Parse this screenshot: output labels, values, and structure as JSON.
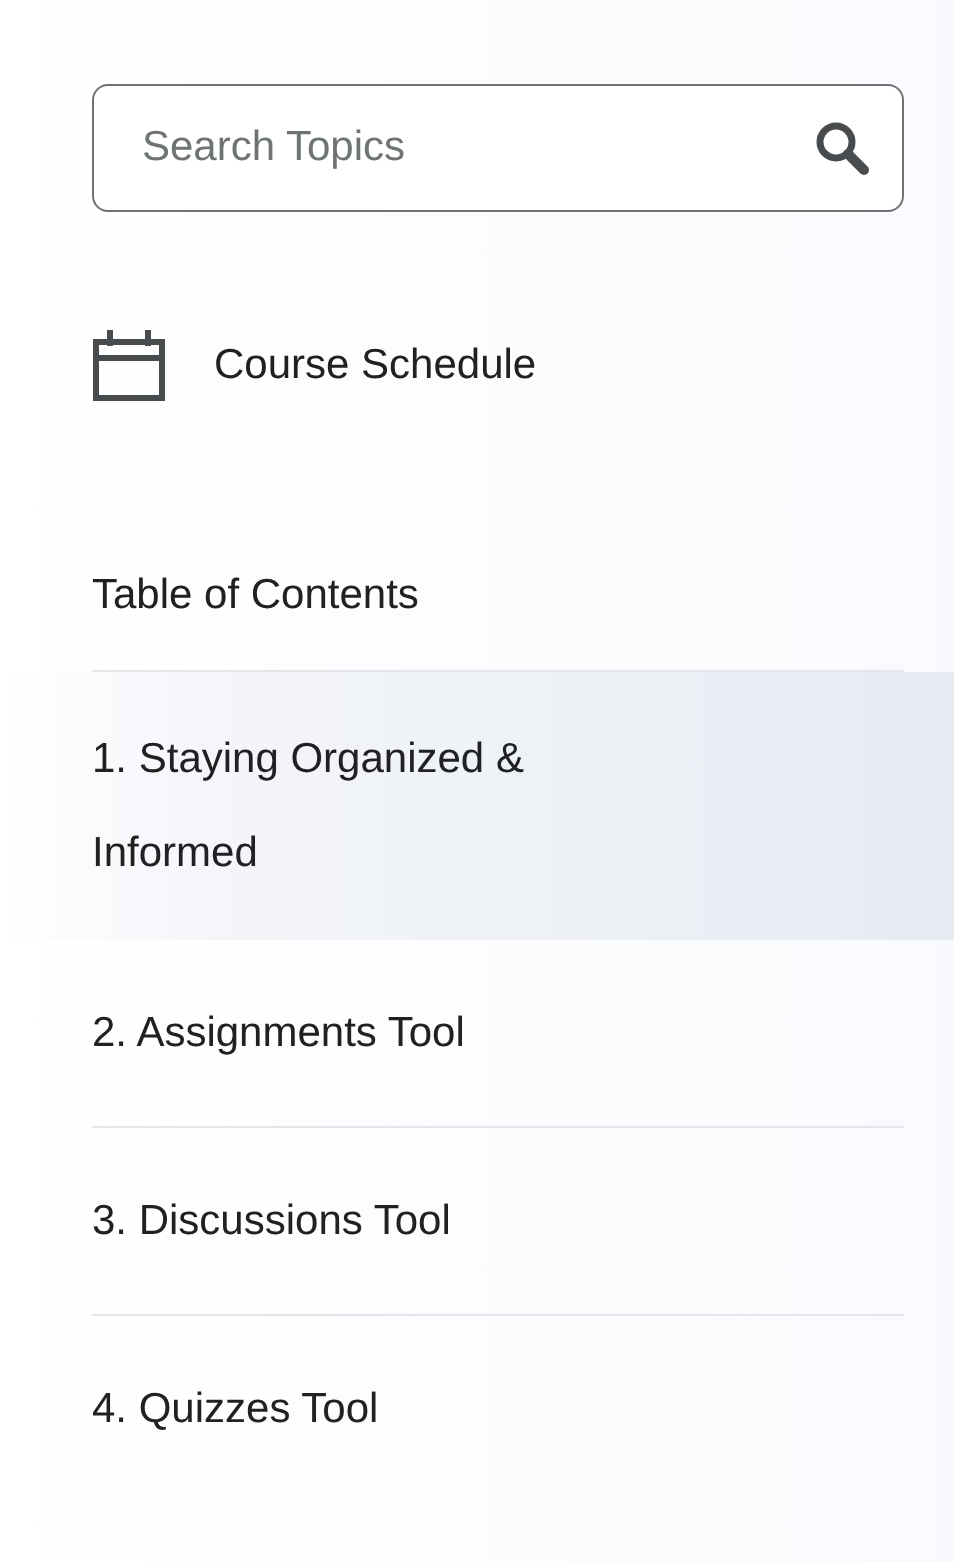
{
  "search": {
    "placeholder": "Search Topics"
  },
  "course_schedule": {
    "label": "Course Schedule"
  },
  "table_of_contents": {
    "heading": "Table of Contents",
    "items": [
      {
        "label": "1. Staying Organized & Informed",
        "selected": true
      },
      {
        "label": "2. Assignments Tool",
        "selected": false
      },
      {
        "label": "3. Discussions Tool",
        "selected": false
      },
      {
        "label": "4. Quizzes Tool",
        "selected": false
      }
    ]
  }
}
